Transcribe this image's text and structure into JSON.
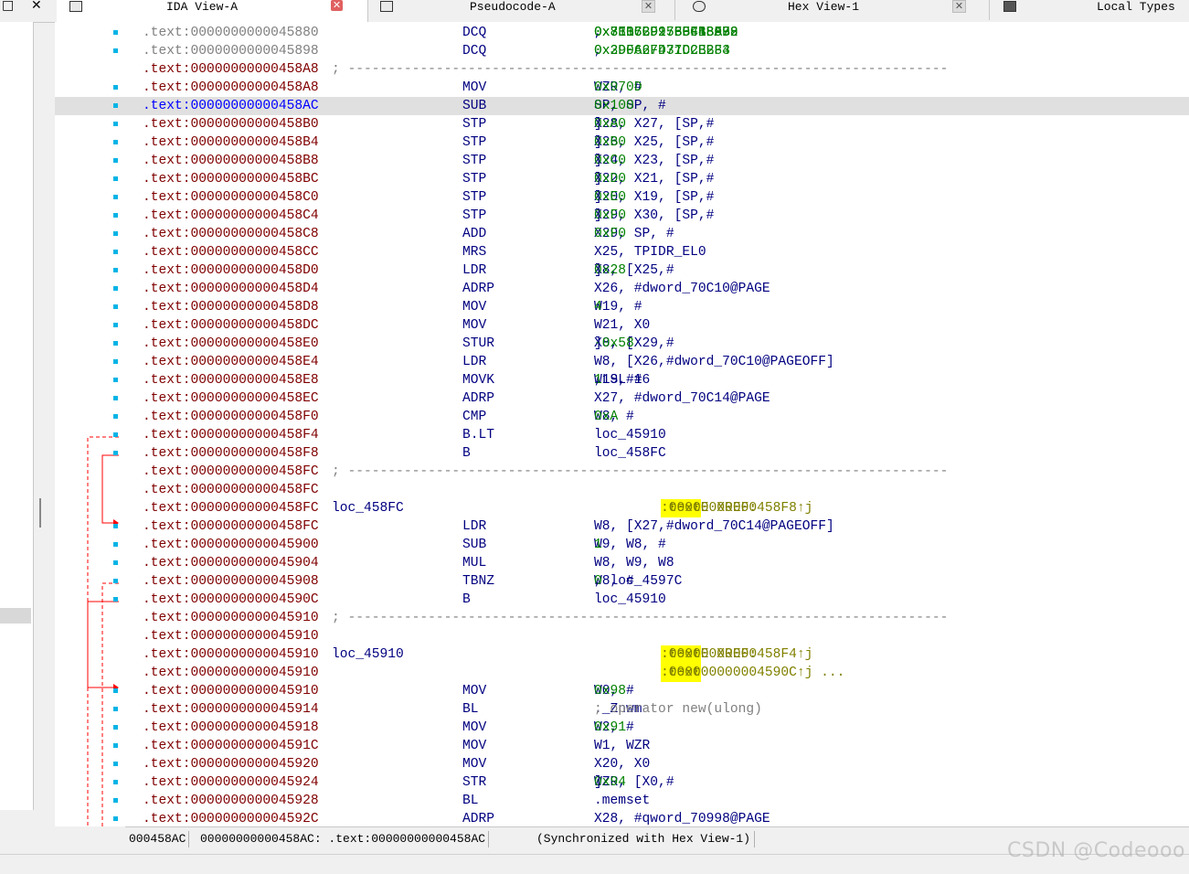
{
  "window_controls": {
    "restore": "□",
    "close": "✕"
  },
  "tabs": [
    {
      "id": "ida",
      "label": "IDA View-A",
      "close": "✕",
      "active": true
    },
    {
      "id": "pseudo",
      "label": "Pseudocode-A",
      "close": "✕",
      "active": false
    },
    {
      "id": "hex",
      "label": "Hex View-1",
      "close": "✕",
      "active": false
    },
    {
      "id": "local",
      "label": "Local Types",
      "active": false
    }
  ],
  "listing": [
    {
      "addr": ".text:0000000000045880",
      "gray": true,
      "dot": true,
      "mn": "DCQ",
      "ops": [
        [
          "n",
          "0x8E0C2F95FBF1BA72"
        ],
        [
          "t",
          ", "
        ],
        [
          "n",
          "0x7317BD27BF4480B8"
        ],
        [
          "t",
          ", "
        ],
        [
          "n",
          "0x31B5C91760CB8F99"
        ]
      ]
    },
    {
      "addr": ".text:0000000000045898",
      "gray": true,
      "dot": true,
      "mn": "DCQ",
      "ops": [
        [
          "n",
          "0x3D0A6FD37C2E2F3"
        ],
        [
          "t",
          ", "
        ],
        [
          "n",
          "0x29F627471DCBB34"
        ]
      ]
    },
    {
      "addr": ".text:00000000000458A8",
      "sep": "; ---------------------------------------------------------------------------"
    },
    {
      "addr": ".text:00000000000458A8",
      "dot": true,
      "mn": "MOV",
      "ops": [
        [
          "t",
          "WZR, #"
        ],
        [
          "n",
          "0x970D"
        ]
      ]
    },
    {
      "addr": ".text:00000000000458AC",
      "cur": true,
      "dot": true,
      "mn": "SUB",
      "ops": [
        [
          "t",
          "SP, SP, #"
        ],
        [
          "n",
          "0x100"
        ]
      ]
    },
    {
      "addr": ".text:00000000000458B0",
      "dot": true,
      "mn": "STP",
      "ops": [
        [
          "t",
          "X28, X27, [SP,#"
        ],
        [
          "n",
          "0xA0"
        ],
        [
          "t",
          "]"
        ]
      ]
    },
    {
      "addr": ".text:00000000000458B4",
      "dot": true,
      "mn": "STP",
      "ops": [
        [
          "t",
          "X26, X25, [SP,#"
        ],
        [
          "n",
          "0xB0"
        ],
        [
          "t",
          "]"
        ]
      ]
    },
    {
      "addr": ".text:00000000000458B8",
      "dot": true,
      "mn": "STP",
      "ops": [
        [
          "t",
          "X24, X23, [SP,#"
        ],
        [
          "n",
          "0xC0"
        ],
        [
          "t",
          "]"
        ]
      ]
    },
    {
      "addr": ".text:00000000000458BC",
      "dot": true,
      "mn": "STP",
      "ops": [
        [
          "t",
          "X22, X21, [SP,#"
        ],
        [
          "n",
          "0xD0"
        ],
        [
          "t",
          "]"
        ]
      ]
    },
    {
      "addr": ".text:00000000000458C0",
      "dot": true,
      "mn": "STP",
      "ops": [
        [
          "t",
          "X20, X19, [SP,#"
        ],
        [
          "n",
          "0xE0"
        ],
        [
          "t",
          "]"
        ]
      ]
    },
    {
      "addr": ".text:00000000000458C4",
      "dot": true,
      "mn": "STP",
      "ops": [
        [
          "t",
          "X29, X30, [SP,#"
        ],
        [
          "n",
          "0xF0"
        ],
        [
          "t",
          "]"
        ]
      ]
    },
    {
      "addr": ".text:00000000000458C8",
      "dot": true,
      "mn": "ADD",
      "ops": [
        [
          "t",
          "X29, SP, #"
        ],
        [
          "n",
          "0xF0"
        ]
      ]
    },
    {
      "addr": ".text:00000000000458CC",
      "dot": true,
      "mn": "MRS",
      "ops": [
        [
          "t",
          "X25, TPIDR_EL0"
        ]
      ]
    },
    {
      "addr": ".text:00000000000458D0",
      "dot": true,
      "mn": "LDR",
      "ops": [
        [
          "t",
          "X8, [X25,#"
        ],
        [
          "n",
          "0x28"
        ],
        [
          "t",
          "]"
        ]
      ]
    },
    {
      "addr": ".text:00000000000458D4",
      "dot": true,
      "mn": "ADRP",
      "ops": [
        [
          "t",
          "X26, #dword_70C10@PAGE"
        ]
      ]
    },
    {
      "addr": ".text:00000000000458D8",
      "dot": true,
      "mn": "MOV",
      "ops": [
        [
          "t",
          "W19, #"
        ],
        [
          "n",
          "4"
        ]
      ]
    },
    {
      "addr": ".text:00000000000458DC",
      "dot": true,
      "mn": "MOV",
      "ops": [
        [
          "t",
          "W21, X0"
        ]
      ]
    },
    {
      "addr": ".text:00000000000458E0",
      "dot": true,
      "mn": "STUR",
      "ops": [
        [
          "t",
          "X8, [X29,#"
        ],
        [
          "n",
          "-0x58"
        ],
        [
          "t",
          "]"
        ]
      ]
    },
    {
      "addr": ".text:00000000000458E4",
      "dot": true,
      "mn": "LDR",
      "ops": [
        [
          "t",
          "W8, [X26,#dword_70C10@PAGEOFF]"
        ]
      ]
    },
    {
      "addr": ".text:00000000000458E8",
      "dot": true,
      "mn": "MOVK",
      "ops": [
        [
          "t",
          "W19, #"
        ],
        [
          "n",
          "1"
        ],
        [
          "t",
          ",LSL#16"
        ]
      ]
    },
    {
      "addr": ".text:00000000000458EC",
      "dot": true,
      "mn": "ADRP",
      "ops": [
        [
          "t",
          "X27, #dword_70C14@PAGE"
        ]
      ]
    },
    {
      "addr": ".text:00000000000458F0",
      "dot": true,
      "mn": "CMP",
      "ops": [
        [
          "t",
          "W8, #"
        ],
        [
          "n",
          "0xA"
        ]
      ]
    },
    {
      "addr": ".text:00000000000458F4",
      "dot": true,
      "mn": "B.LT",
      "ops": [
        [
          "t",
          "loc_45910"
        ]
      ]
    },
    {
      "addr": ".text:00000000000458F8",
      "dot": true,
      "mn": "B",
      "ops": [
        [
          "t",
          "loc_458FC"
        ]
      ]
    },
    {
      "addr": ".text:00000000000458FC",
      "sep": "; ---------------------------------------------------------------------------"
    },
    {
      "addr": ".text:00000000000458FC"
    },
    {
      "addr": ".text:00000000000458FC",
      "label": "loc_458FC",
      "xref": {
        "prefix": "; CODE XREF: ",
        "seg": ".text",
        "rest": ":00000000000458F8↑j"
      }
    },
    {
      "addr": ".text:00000000000458FC",
      "dot": true,
      "mn": "LDR",
      "ops": [
        [
          "t",
          "W8, [X27,#dword_70C14@PAGEOFF]"
        ]
      ]
    },
    {
      "addr": ".text:0000000000045900",
      "dot": true,
      "mn": "SUB",
      "ops": [
        [
          "t",
          "W9, W8, #"
        ],
        [
          "n",
          "1"
        ]
      ]
    },
    {
      "addr": ".text:0000000000045904",
      "dot": true,
      "mn": "MUL",
      "ops": [
        [
          "t",
          "W8, W9, W8"
        ]
      ]
    },
    {
      "addr": ".text:0000000000045908",
      "dot": true,
      "mn": "TBNZ",
      "ops": [
        [
          "t",
          "W8, #"
        ],
        [
          "n",
          "0"
        ],
        [
          "t",
          ", loc_4597C"
        ]
      ]
    },
    {
      "addr": ".text:000000000004590C",
      "dot": true,
      "mn": "B",
      "ops": [
        [
          "t",
          "loc_45910"
        ]
      ]
    },
    {
      "addr": ".text:0000000000045910",
      "sep": "; ---------------------------------------------------------------------------"
    },
    {
      "addr": ".text:0000000000045910"
    },
    {
      "addr": ".text:0000000000045910",
      "label": "loc_45910",
      "xref": {
        "prefix": "; CODE XREF: ",
        "seg": ".text",
        "rest": ":00000000000458F4↑j"
      }
    },
    {
      "addr": ".text:0000000000045910",
      "xref": {
        "prefix": "; ",
        "seg": ".text",
        "rest": ":000000000004590C↑j ..."
      }
    },
    {
      "addr": ".text:0000000000045910",
      "dot": true,
      "mn": "MOV",
      "ops": [
        [
          "t",
          "W0, #"
        ],
        [
          "n",
          "0x98"
        ]
      ]
    },
    {
      "addr": ".text:0000000000045914",
      "dot": true,
      "mn": "BL",
      "ops": [
        [
          "t",
          "._Znwm"
        ]
      ],
      "comment": "; operator new(ulong)"
    },
    {
      "addr": ".text:0000000000045918",
      "dot": true,
      "mn": "MOV",
      "ops": [
        [
          "t",
          "W2, #"
        ],
        [
          "n",
          "0x91"
        ]
      ]
    },
    {
      "addr": ".text:000000000004591C",
      "dot": true,
      "mn": "MOV",
      "ops": [
        [
          "t",
          "W1, WZR"
        ]
      ]
    },
    {
      "addr": ".text:0000000000045920",
      "dot": true,
      "mn": "MOV",
      "ops": [
        [
          "t",
          "X20, X0"
        ]
      ]
    },
    {
      "addr": ".text:0000000000045924",
      "dot": true,
      "mn": "STR",
      "ops": [
        [
          "t",
          "WZR, [X0,#"
        ],
        [
          "n",
          "0x94"
        ],
        [
          "t",
          "]"
        ]
      ]
    },
    {
      "addr": ".text:0000000000045928",
      "dot": true,
      "mn": "BL",
      "ops": [
        [
          "t",
          ".memset"
        ]
      ]
    },
    {
      "addr": ".text:000000000004592C",
      "dot": true,
      "mn": "ADRP",
      "ops": [
        [
          "t",
          "X28, #qword_70998@PAGE"
        ]
      ]
    }
  ],
  "status": {
    "offset": "000458AC",
    "location": "00000000000458AC: .text:00000000000458AC",
    "sync": "(Synchronized with Hex View-1)"
  },
  "watermark": "CSDN @Codeooo",
  "colors": {
    "address": "#800000",
    "address_gray": "#808080",
    "mnemonic": "#000080",
    "number": "#008000",
    "xref_highlight": "#ffff00",
    "breakpoint_dot": "#00b4e6",
    "flow_arrow": "#ff0000"
  }
}
